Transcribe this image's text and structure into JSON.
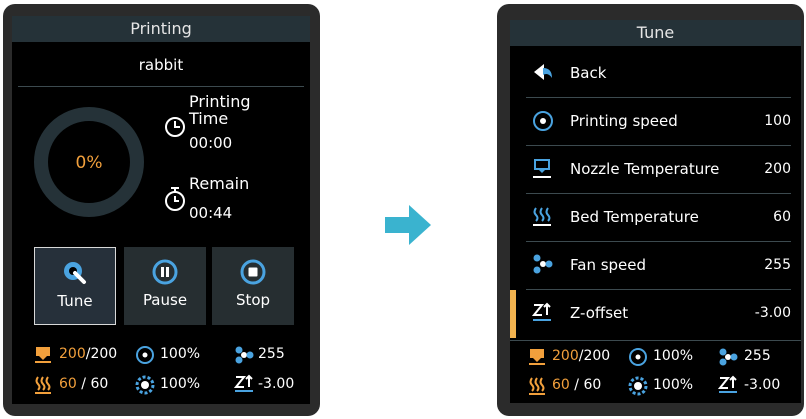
{
  "left_screen": {
    "title": "Printing",
    "filename": "rabbit",
    "progress_percent": "0%",
    "printing_time_label_1": "Printing",
    "printing_time_label_2": "Time",
    "printing_time_value": "00:00",
    "remain_label": "Remain",
    "remain_value": "00:44",
    "buttons": {
      "tune": "Tune",
      "pause": "Pause",
      "stop": "Stop"
    },
    "status": {
      "nozzle_current": "200",
      "nozzle_target": "/200",
      "speed": "100%",
      "fan": "255",
      "bed_current": "60",
      "bed_sep": "/",
      "bed_target": "60",
      "flow": "100%",
      "zoffset": "-3.00"
    }
  },
  "right_screen": {
    "title": "Tune",
    "back_label": "Back",
    "items": [
      {
        "label": "Printing speed",
        "value": "100"
      },
      {
        "label": "Nozzle Temperature",
        "value": "200"
      },
      {
        "label": "Bed Temperature",
        "value": "60"
      },
      {
        "label": "Fan speed",
        "value": "255"
      },
      {
        "label": "Z-offset",
        "value": "-3.00"
      }
    ],
    "status": {
      "nozzle_current": "200",
      "nozzle_target": "/200",
      "speed": "100%",
      "fan": "255",
      "bed_current": "60",
      "bed_sep": "/",
      "bed_target": "60",
      "flow": "100%",
      "zoffset": "-3.00"
    }
  },
  "colors": {
    "accent": "#f2a03c",
    "arrow": "#3ab3cf",
    "titlebar": "#253238",
    "icon_blue": "#4aa3e0"
  }
}
